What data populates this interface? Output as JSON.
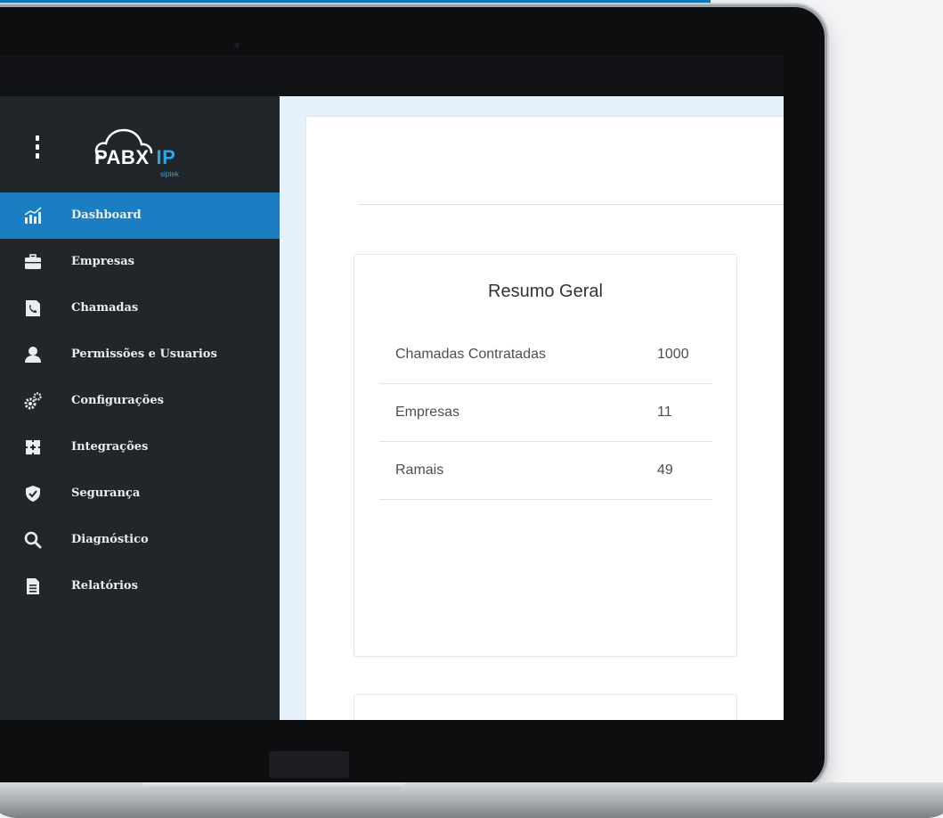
{
  "logo": {
    "wordmark": "PABX",
    "accent": "IP",
    "subtitle": "siptek"
  },
  "sidebar": {
    "items": [
      {
        "label": "Dashboard",
        "icon": "dashboard-chart-icon",
        "active": true
      },
      {
        "label": "Empresas",
        "icon": "briefcase-icon",
        "active": false
      },
      {
        "label": "Chamadas",
        "icon": "phone-document-icon",
        "active": false
      },
      {
        "label": "Permissões e Usuarios",
        "icon": "user-icon",
        "active": false
      },
      {
        "label": "Configurações",
        "icon": "gears-icon",
        "active": false
      },
      {
        "label": "Integrações",
        "icon": "puzzle-icon",
        "active": false
      },
      {
        "label": "Segurança",
        "icon": "shield-icon",
        "active": false
      },
      {
        "label": "Diagnóstico",
        "icon": "search-icon",
        "active": false
      },
      {
        "label": "Relatórios",
        "icon": "document-icon",
        "active": false
      }
    ]
  },
  "summary": {
    "title": "Resumo Geral",
    "rows": [
      {
        "label": "Chamadas Contratadas",
        "value": "1000"
      },
      {
        "label": "Empresas",
        "value": "11"
      },
      {
        "label": "Ramais",
        "value": "49"
      }
    ]
  },
  "colors": {
    "sidebar_bg": "#21262b",
    "active_item": "#1b7ec2",
    "logo_accent": "#2ba7e6",
    "main_bg": "#e7f1fb"
  }
}
